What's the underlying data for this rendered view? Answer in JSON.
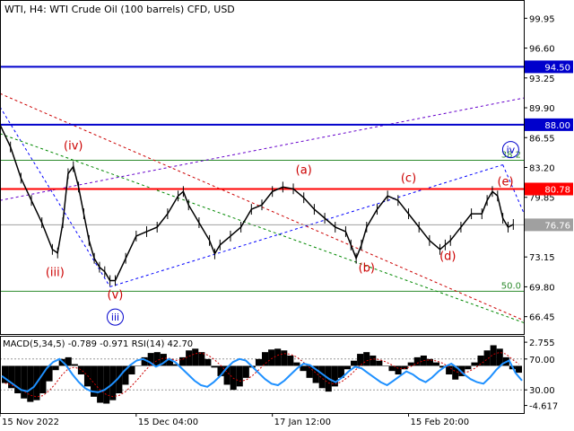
{
  "header": {
    "title": "WTI, H4:  WTI Crude Oil (100 barrels) CFD, USD"
  },
  "chart_data": [
    {
      "type": "line",
      "title": "WTI, H4:  WTI Crude Oil (100 barrels) CFD, USD",
      "ylim": [
        64.5,
        102.0
      ],
      "xlim": [
        0,
        100
      ],
      "x_ticks": [
        {
          "x": 0,
          "label": "15 Nov 2022"
        },
        {
          "x": 26,
          "label": "15 Dec 04:00"
        },
        {
          "x": 52,
          "label": "17 Jan 12:00"
        },
        {
          "x": 78,
          "label": "15 Feb 20:00"
        }
      ],
      "y_ticks": [
        99.95,
        96.6,
        93.25,
        89.9,
        86.55,
        83.2,
        79.85,
        76.5,
        73.15,
        69.8,
        66.45
      ],
      "series": [
        {
          "values": [
            [
              0,
              88.0
            ],
            [
              2,
              85.5
            ],
            [
              4,
              82.0
            ],
            [
              6,
              79.5
            ],
            [
              8,
              77.0
            ],
            [
              10,
              74.0
            ],
            [
              11,
              73.6
            ],
            [
              12,
              77.0
            ],
            [
              13,
              82.5
            ],
            [
              14,
              83.3
            ],
            [
              15,
              81.0
            ],
            [
              16,
              78.0
            ],
            [
              17,
              75.0
            ],
            [
              18,
              73.0
            ],
            [
              19,
              72.0
            ],
            [
              20,
              71.5
            ],
            [
              21,
              70.5
            ],
            [
              22,
              70.5
            ],
            [
              24,
              73.0
            ],
            [
              26,
              75.5
            ],
            [
              28,
              76.0
            ],
            [
              30,
              76.5
            ],
            [
              32,
              78.0
            ],
            [
              34,
              80.0
            ],
            [
              35,
              80.5
            ],
            [
              36,
              79.0
            ],
            [
              38,
              77.0
            ],
            [
              40,
              75.0
            ],
            [
              41,
              73.5
            ],
            [
              42,
              74.5
            ],
            [
              44,
              75.5
            ],
            [
              46,
              76.5
            ],
            [
              48,
              78.5
            ],
            [
              50,
              79.0
            ],
            [
              52,
              80.5
            ],
            [
              54,
              81.0
            ],
            [
              56,
              80.8
            ],
            [
              58,
              79.8
            ],
            [
              60,
              78.5
            ],
            [
              62,
              77.5
            ],
            [
              64,
              76.5
            ],
            [
              66,
              76.0
            ],
            [
              67,
              74.5
            ],
            [
              68,
              73.0
            ],
            [
              69,
              74.5
            ],
            [
              70,
              76.5
            ],
            [
              72,
              78.5
            ],
            [
              74,
              80.0
            ],
            [
              76,
              79.5
            ],
            [
              78,
              78.0
            ],
            [
              80,
              76.5
            ],
            [
              82,
              75.0
            ],
            [
              84,
              74.0
            ],
            [
              85,
              74.5
            ],
            [
              86,
              75.0
            ],
            [
              88,
              76.5
            ],
            [
              90,
              78.0
            ],
            [
              92,
              78.0
            ],
            [
              93,
              79.5
            ],
            [
              94,
              80.5
            ],
            [
              95,
              80.0
            ],
            [
              96,
              77.5
            ],
            [
              97,
              76.5
            ],
            [
              98,
              76.8
            ]
          ]
        }
      ],
      "levels": [
        {
          "label": "94.50",
          "value": 94.5,
          "color": "#0000cc"
        },
        {
          "label": "88.00",
          "value": 88.0,
          "color": "#0000cc"
        },
        {
          "label": "80.78",
          "value": 80.78,
          "color": "#ff0000"
        },
        {
          "label": "76.76",
          "value": 76.76,
          "color": "#a0a0a0"
        }
      ],
      "fib": [
        {
          "label": "38.2",
          "value": 84.0
        },
        {
          "label": "50.0",
          "value": 69.3
        }
      ],
      "trendlines": [
        {
          "color": "#6600cc",
          "points": [
            [
              0,
              79.5
            ],
            [
              100,
              91.0
            ]
          ]
        },
        {
          "color": "#0000ff",
          "points": [
            [
              21,
              69.8
            ],
            [
              96,
              83.5
            ]
          ]
        },
        {
          "color": "#0000ff",
          "points": [
            [
              96,
              83.5
            ],
            [
              106,
              70.0
            ]
          ]
        },
        {
          "color": "#0000ff",
          "points": [
            [
              0,
              90.0
            ],
            [
              21,
              69.8
            ]
          ]
        },
        {
          "color": "#cc0000",
          "points": [
            [
              0,
              91.5
            ],
            [
              106,
              64.5
            ]
          ]
        },
        {
          "color": "#008800",
          "points": [
            [
              0,
              87.0
            ],
            [
              106,
              64.5
            ]
          ]
        }
      ],
      "wave_labels": [
        {
          "text": "(iv)",
          "x": 14,
          "y": 85.2,
          "color": "#cc0000"
        },
        {
          "text": "(iii)",
          "x": 10.5,
          "y": 71.0,
          "color": "#cc0000"
        },
        {
          "text": "(v)",
          "x": 22,
          "y": 68.5,
          "color": "#cc0000"
        },
        {
          "text": "iii",
          "x": 22,
          "y": 66.0,
          "color": "#0000cc",
          "circled": true
        },
        {
          "text": "(a)",
          "x": 58,
          "y": 82.5,
          "color": "#cc0000"
        },
        {
          "text": "(b)",
          "x": 70,
          "y": 71.5,
          "color": "#cc0000"
        },
        {
          "text": "(c)",
          "x": 78,
          "y": 81.6,
          "color": "#cc0000"
        },
        {
          "text": "(d)",
          "x": 85.5,
          "y": 72.8,
          "color": "#cc0000"
        },
        {
          "text": "(e)",
          "x": 96.5,
          "y": 81.2,
          "color": "#cc0000"
        },
        {
          "text": "iv",
          "x": 97.5,
          "y": 84.8,
          "color": "#0000cc",
          "circled": true
        }
      ]
    },
    {
      "type": "bar",
      "title": "MACD(5,34,5) -0.789 -0.971 RSI(14) 42.70",
      "indicator_label": "MACD(5,34,5) -0.789 -0.971 RSI(14) 42.70",
      "ylim": [
        -5.5,
        3.5
      ],
      "y_ticks": [
        {
          "label": "2.755",
          "value": 2.755
        },
        {
          "label": "70.00",
          "value": 70.0,
          "scale": "rsi"
        },
        {
          "label": "30.00",
          "value": 30.0,
          "scale": "rsi"
        },
        {
          "label": "-4.617",
          "value": -4.617
        }
      ],
      "macd_values": [
        -2.0,
        -2.6,
        -3.2,
        -3.8,
        -4.2,
        -4.0,
        -3.2,
        -1.8,
        -0.5,
        0.8,
        1.0,
        0.2,
        -1.0,
        -2.4,
        -3.6,
        -4.3,
        -4.4,
        -4.0,
        -3.2,
        -2.2,
        -1.0,
        0.0,
        1.0,
        1.5,
        1.6,
        1.4,
        0.8,
        0.2,
        1.0,
        1.8,
        2.0,
        1.6,
        0.8,
        -0.2,
        -1.2,
        -2.2,
        -2.8,
        -2.4,
        -1.4,
        -0.2,
        0.8,
        1.6,
        1.9,
        2.0,
        1.8,
        1.2,
        0.4,
        -0.6,
        -1.4,
        -2.0,
        -2.6,
        -3.0,
        -2.4,
        -1.4,
        -0.4,
        0.6,
        1.4,
        1.6,
        1.2,
        0.6,
        0.0,
        -0.6,
        -1.0,
        -0.4,
        0.4,
        1.0,
        1.2,
        0.8,
        0.4,
        -0.2,
        -1.0,
        -1.6,
        -1.2,
        -0.4,
        0.4,
        1.2,
        1.8,
        2.4,
        2.0,
        1.0,
        -0.4,
        -0.8
      ],
      "rsi_values": [
        48,
        42,
        36,
        30,
        28,
        34,
        46,
        58,
        66,
        70,
        62,
        50,
        40,
        32,
        28,
        27,
        30,
        36,
        44,
        54,
        62,
        68,
        70,
        66,
        60,
        64,
        70,
        66,
        58,
        50,
        42,
        36,
        34,
        40,
        48,
        58,
        66,
        70,
        68,
        60,
        52,
        44,
        38,
        36,
        42,
        50,
        58,
        64,
        62,
        56,
        50,
        44,
        40,
        46,
        54,
        60,
        58,
        52,
        46,
        40,
        36,
        42,
        48,
        54,
        50,
        44,
        40,
        46,
        54,
        60,
        64,
        58,
        50,
        44,
        40,
        38,
        46,
        56,
        64,
        68,
        52,
        42
      ]
    }
  ]
}
